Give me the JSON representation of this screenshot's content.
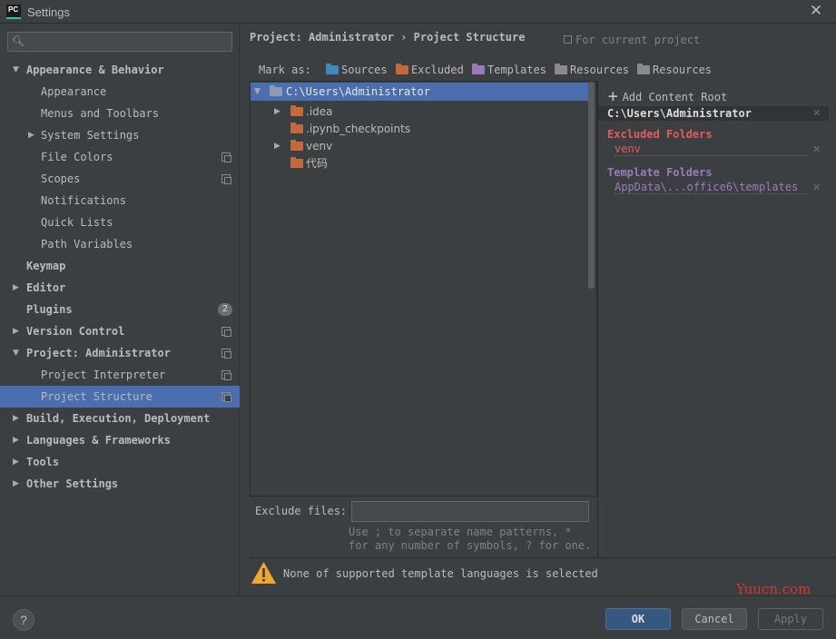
{
  "window": {
    "title": "Settings",
    "logo_text": "PC"
  },
  "sidebar": {
    "search_placeholder": "",
    "items": [
      {
        "label": "Appearance & Behavior",
        "expanded": true,
        "bold": true
      },
      {
        "label": "Appearance"
      },
      {
        "label": "Menus and Toolbars"
      },
      {
        "label": "System Settings",
        "collapsed": true
      },
      {
        "label": "File Colors",
        "project_icon": true
      },
      {
        "label": "Scopes",
        "project_icon": true
      },
      {
        "label": "Notifications"
      },
      {
        "label": "Quick Lists"
      },
      {
        "label": "Path Variables"
      },
      {
        "label": "Keymap",
        "bold": true
      },
      {
        "label": "Editor",
        "collapsed": true,
        "bold": true
      },
      {
        "label": "Plugins",
        "bold": true,
        "badge": "2"
      },
      {
        "label": "Version Control",
        "collapsed": true,
        "bold": true,
        "project_icon": true
      },
      {
        "label": "Project: Administrator",
        "expanded": true,
        "bold": true,
        "project_icon": true
      },
      {
        "label": "Project Interpreter",
        "project_icon": true
      },
      {
        "label": "Project Structure",
        "project_icon": true,
        "selected": true
      },
      {
        "label": "Build, Execution, Deployment",
        "collapsed": true,
        "bold": true
      },
      {
        "label": "Languages & Frameworks",
        "collapsed": true,
        "bold": true
      },
      {
        "label": "Tools",
        "collapsed": true,
        "bold": true
      },
      {
        "label": "Other Settings",
        "collapsed": true,
        "bold": true
      }
    ]
  },
  "header": {
    "breadcrumb": "Project: Administrator › Project Structure",
    "for_current_project": "For current project"
  },
  "mark_as": {
    "label": "Mark as:",
    "options": [
      {
        "label": "Sources",
        "color": "#3d8ab5"
      },
      {
        "label": "Excluded",
        "color": "#c46a3a"
      },
      {
        "label": "Templates",
        "color": "#9c7ab8"
      },
      {
        "label": "Resources",
        "color": "#8a8a8a"
      },
      {
        "label": "Resources",
        "color": "#8a8a8a"
      }
    ]
  },
  "tree": {
    "root": "C:\\Users\\Administrator",
    "children": [
      {
        "label": ".idea",
        "expandable": true
      },
      {
        "label": ".ipynb_checkpoints",
        "expandable": false
      },
      {
        "label": "venv",
        "expandable": true
      },
      {
        "label": "代码",
        "expandable": false
      }
    ]
  },
  "exclude_files": {
    "label": "Exclude files:",
    "value": "",
    "hint_line1": "Use ; to separate name patterns, *",
    "hint_line2": "for any number of symbols, ? for one."
  },
  "roots_panel": {
    "add_label": "Add Content Root",
    "root_path": "C:\\Users\\Administrator",
    "excluded_title": "Excluded Folders",
    "excluded_items": [
      "venv"
    ],
    "template_title": "Template Folders",
    "template_items": [
      "AppData\\...office6\\templates"
    ],
    "colors": {
      "excluded": "#e35b5b",
      "template": "#9c7ab8"
    }
  },
  "warning": {
    "text": "None of supported template languages is selected",
    "icon": "warning-triangle-icon"
  },
  "footer": {
    "help": "?",
    "ok": "OK",
    "cancel": "Cancel",
    "apply": "Apply"
  },
  "watermark": "Yuucn.com"
}
